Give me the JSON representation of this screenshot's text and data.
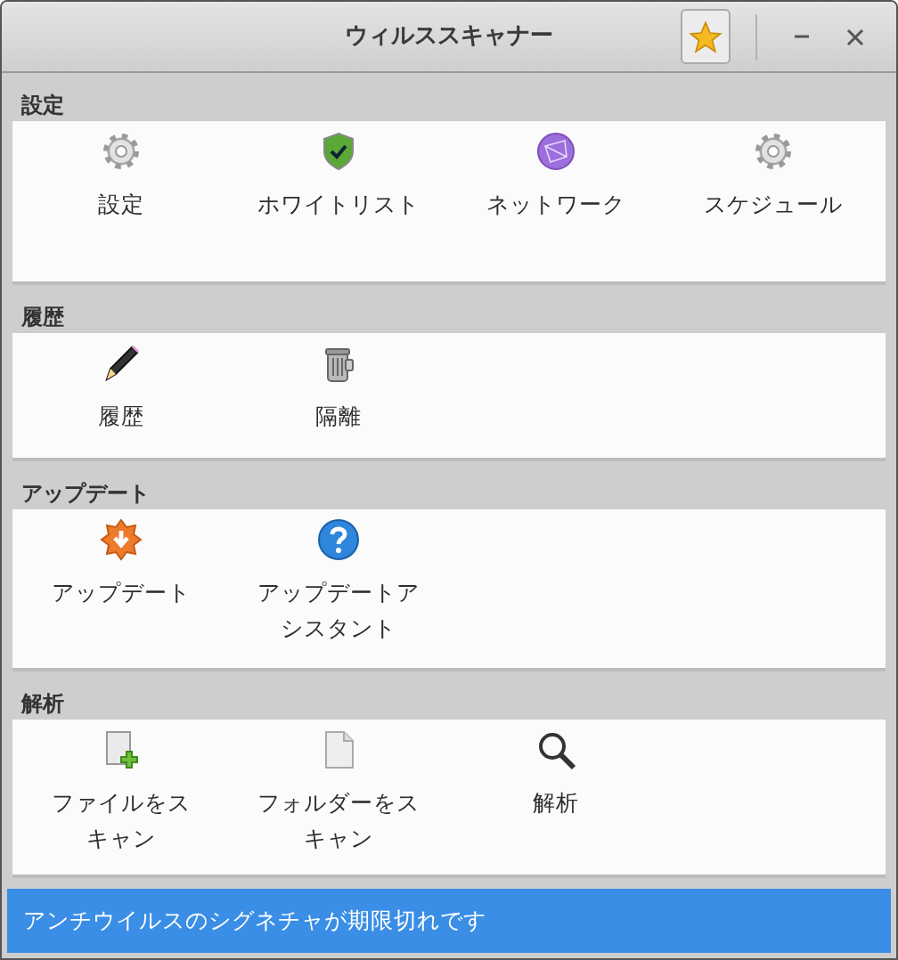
{
  "window": {
    "title": "ウィルススキャナー"
  },
  "sections": [
    {
      "title": "設定",
      "items": [
        {
          "kind": "gear",
          "label_lines": [
            "設定"
          ]
        },
        {
          "kind": "shield",
          "label_lines": [
            "ホワイトリスト"
          ]
        },
        {
          "kind": "network",
          "label_lines": [
            "ネットワーク"
          ]
        },
        {
          "kind": "gear",
          "label_lines": [
            "スケジュール"
          ]
        }
      ]
    },
    {
      "title": "履歴",
      "items": [
        {
          "kind": "pencil",
          "label_lines": [
            "履歴"
          ]
        },
        {
          "kind": "trash",
          "label_lines": [
            "隔離"
          ]
        }
      ]
    },
    {
      "title": "アップデート",
      "items": [
        {
          "kind": "update",
          "label_lines": [
            "アップデート"
          ]
        },
        {
          "kind": "help",
          "label_lines": [
            "アップデートア",
            "シスタント"
          ]
        }
      ]
    },
    {
      "title": "解析",
      "items": [
        {
          "kind": "file-add",
          "label_lines": [
            "ファイルをス",
            "キャン"
          ]
        },
        {
          "kind": "file",
          "label_lines": [
            "フォルダーをス",
            "キャン"
          ]
        },
        {
          "kind": "search",
          "label_lines": [
            "解析"
          ]
        }
      ]
    }
  ],
  "status_bar": {
    "text": "アンチウイルスのシグネチャが期限切れです"
  }
}
